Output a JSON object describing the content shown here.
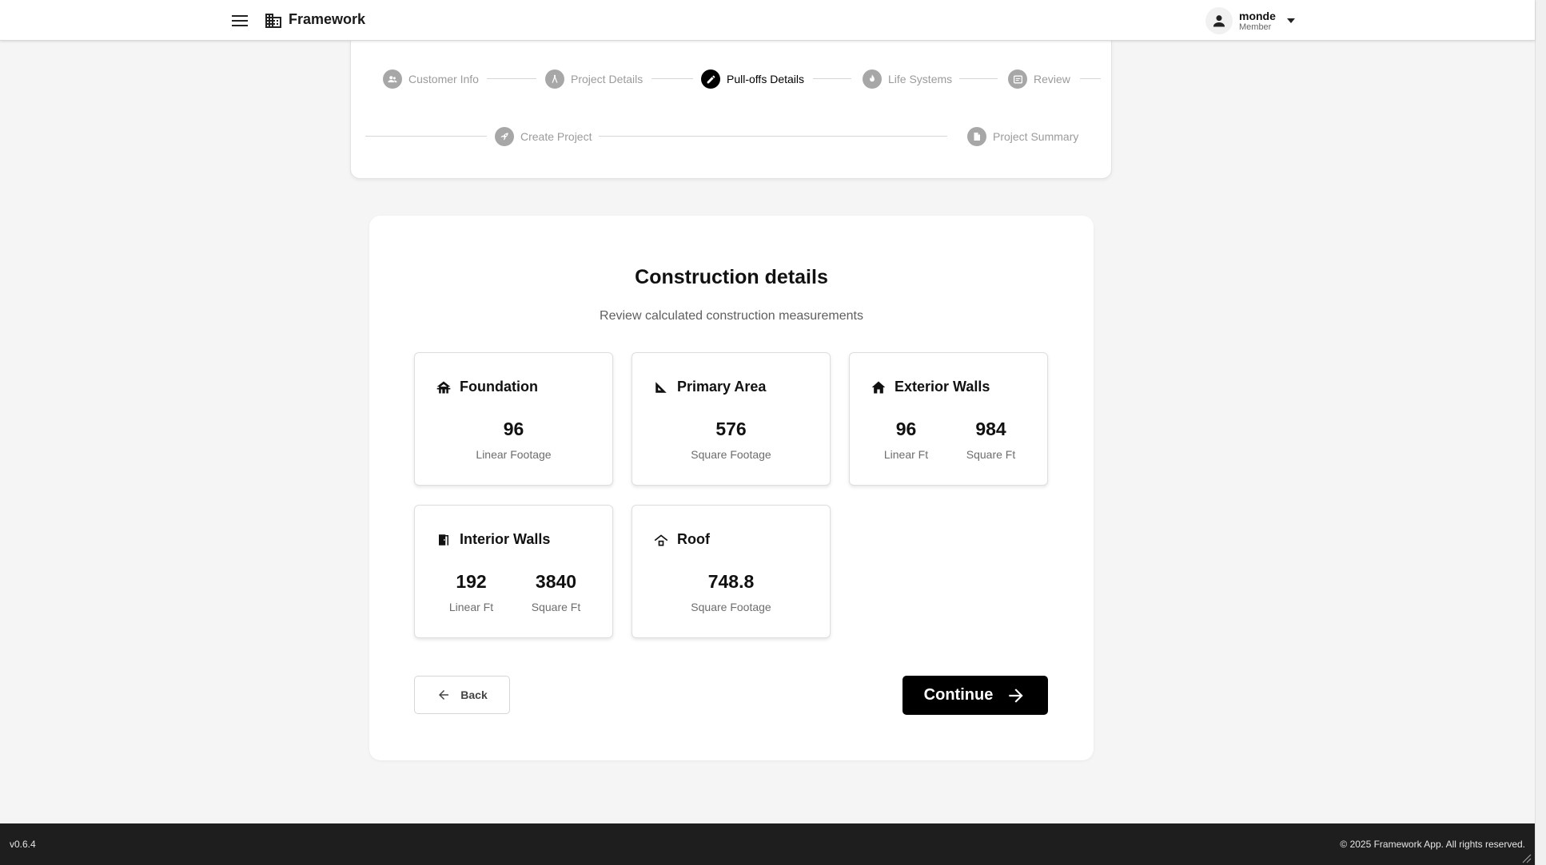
{
  "header": {
    "menu_icon": "hamburger-menu-icon",
    "brand_icon": "building-icon",
    "title": "Framework",
    "user": {
      "name": "monde",
      "role": "Member",
      "avatar_icon": "person-icon"
    }
  },
  "stepper": {
    "steps": [
      {
        "label": "Customer Info",
        "icon": "people-icon",
        "state": "inactive"
      },
      {
        "label": "Project Details",
        "icon": "compass-icon",
        "state": "inactive"
      },
      {
        "label": "Pull-offs Details",
        "icon": "pencil-icon",
        "state": "active"
      },
      {
        "label": "Life Systems",
        "icon": "flame-icon",
        "state": "inactive"
      },
      {
        "label": "Review",
        "icon": "review-list-icon",
        "state": "inactive"
      },
      {
        "label": "Create Project",
        "icon": "rocket-icon",
        "state": "inactive"
      },
      {
        "label": "Project Summary",
        "icon": "document-icon",
        "state": "inactive"
      }
    ]
  },
  "main": {
    "title": "Construction details",
    "subtitle": "Review calculated construction measurements",
    "cards": [
      {
        "title": "Foundation",
        "icon": "foundation-icon",
        "metrics": [
          {
            "value": "96",
            "unit": "Linear Footage"
          }
        ]
      },
      {
        "title": "Primary Area",
        "icon": "set-square-icon",
        "metrics": [
          {
            "value": "576",
            "unit": "Square Footage"
          }
        ]
      },
      {
        "title": "Exterior Walls",
        "icon": "house-icon",
        "metrics": [
          {
            "value": "96",
            "unit": "Linear Ft"
          },
          {
            "value": "984",
            "unit": "Square Ft"
          }
        ]
      },
      {
        "title": "Interior Walls",
        "icon": "door-icon",
        "metrics": [
          {
            "value": "192",
            "unit": "Linear Ft"
          },
          {
            "value": "3840",
            "unit": "Square Ft"
          }
        ]
      },
      {
        "title": "Roof",
        "icon": "roof-icon",
        "metrics": [
          {
            "value": "748.8",
            "unit": "Square Footage"
          }
        ]
      }
    ],
    "back_label": "Back",
    "continue_label": "Continue"
  },
  "footer": {
    "version": "v0.6.4",
    "copyright": "© 2025 Framework App. All rights reserved."
  },
  "colors": {
    "accent": "#000000",
    "inactive_step": "#a7a7a7",
    "footer_bg": "#1e1e1e",
    "page_bg": "#f5f5f5"
  }
}
